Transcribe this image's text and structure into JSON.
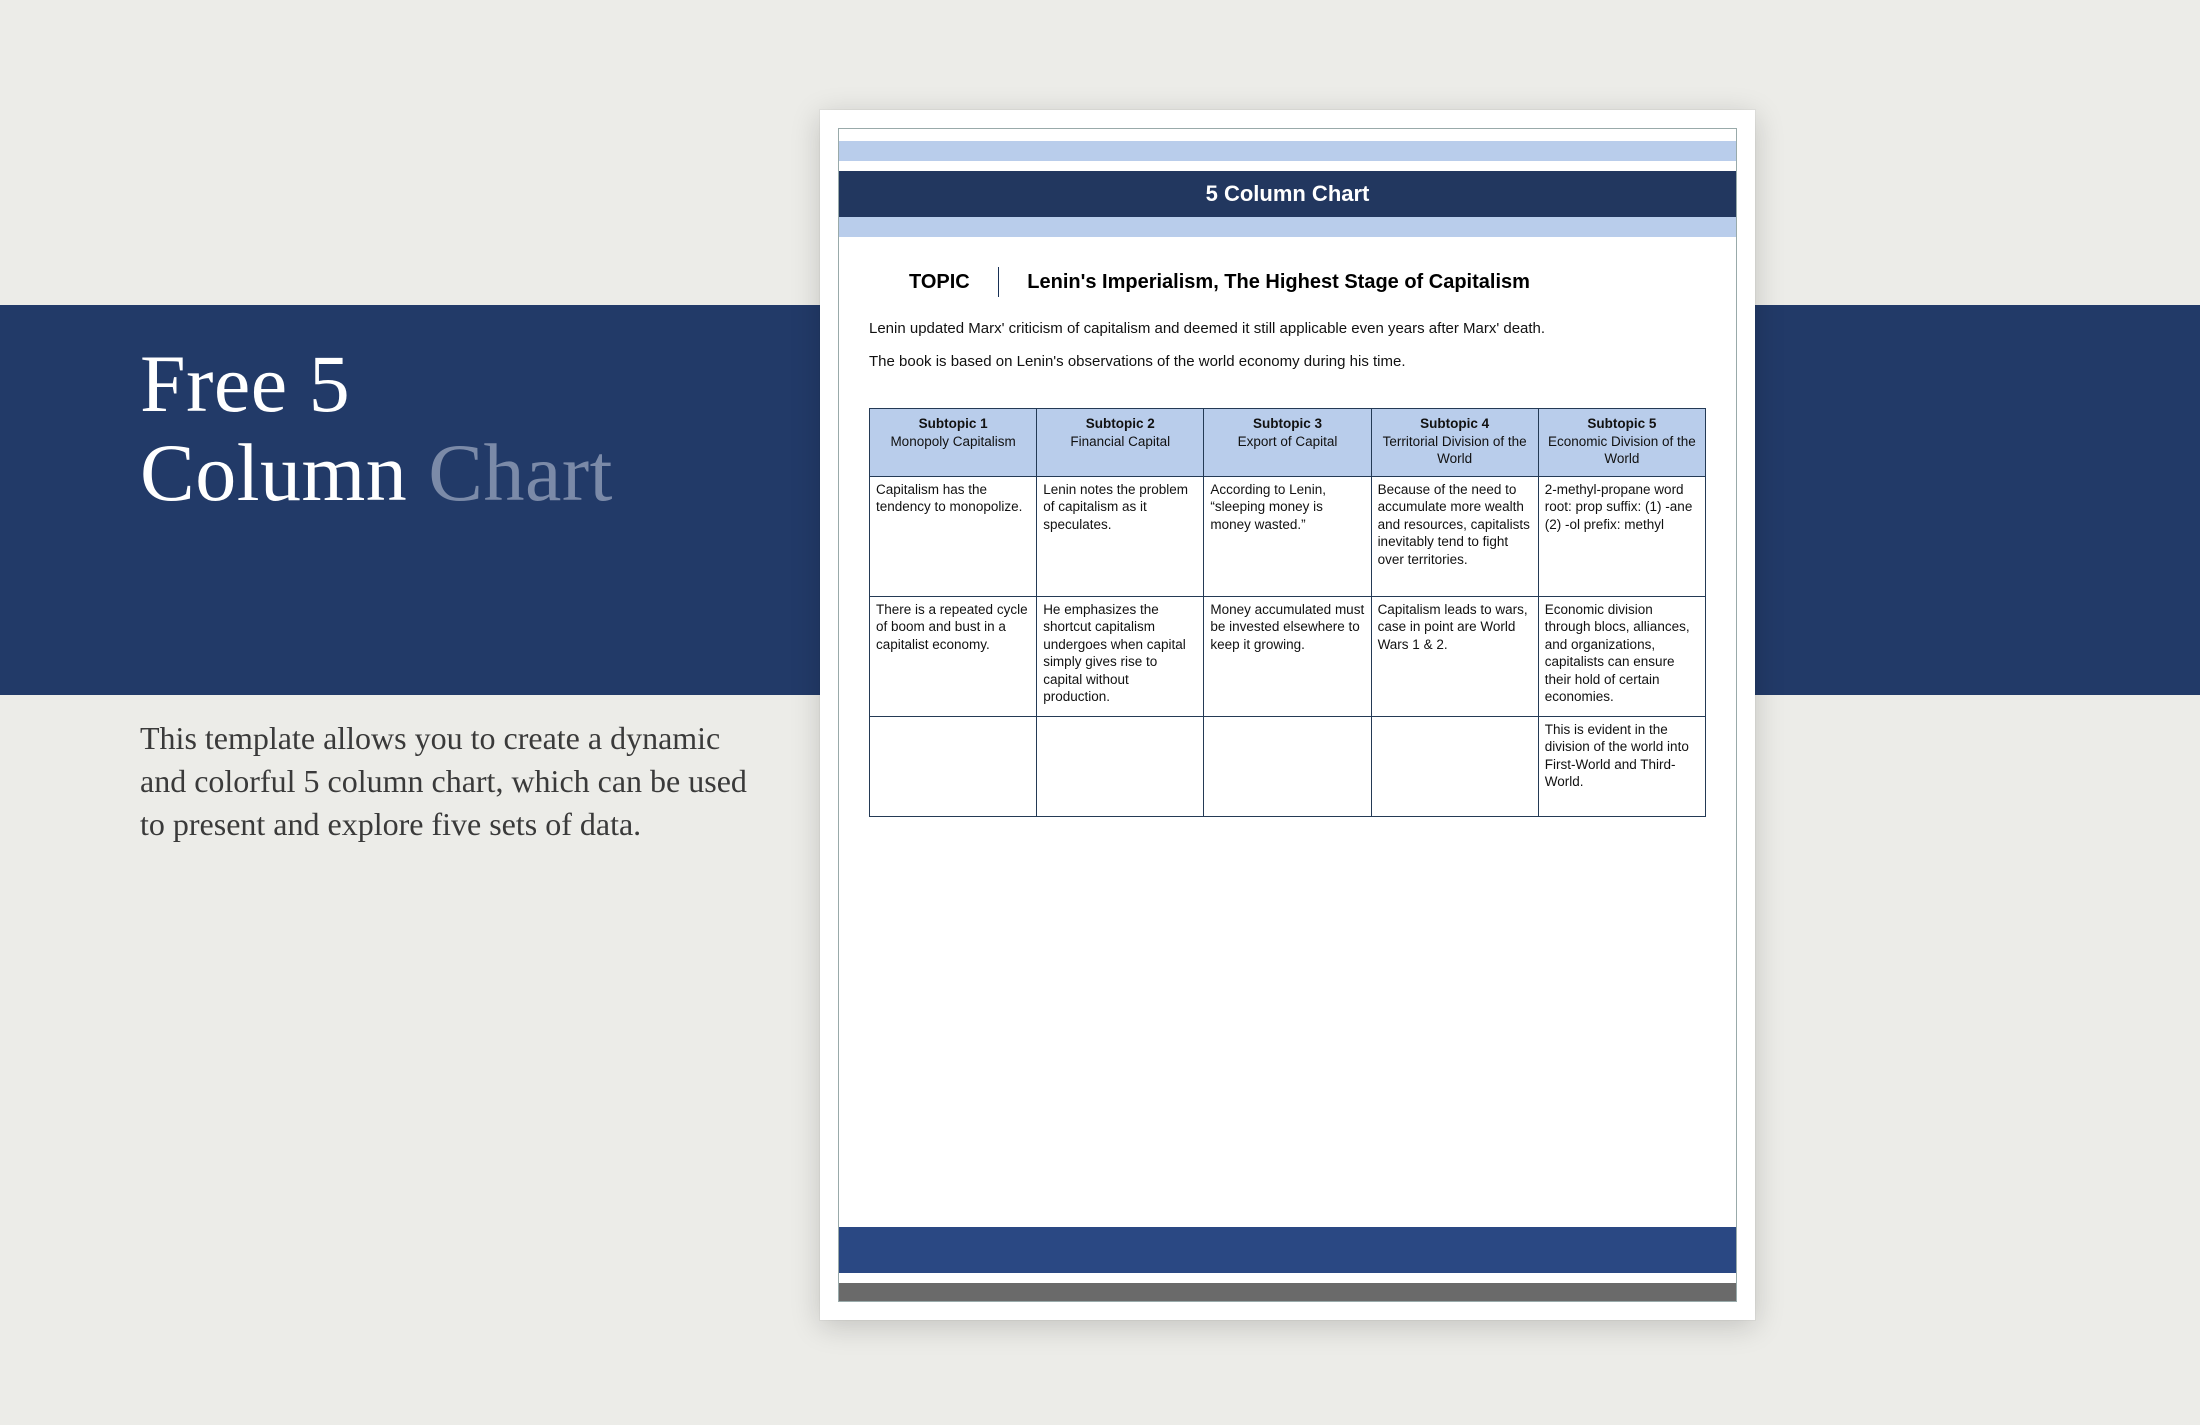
{
  "left": {
    "headline_1": "Free 5",
    "headline_2a": "Column ",
    "headline_2b": "Chart",
    "description": "This template allows you to create a dynamic and colorful 5 column chart, which can be used to present and explore five sets of data."
  },
  "page": {
    "title": "5 Column Chart",
    "topic_label": "TOPIC",
    "topic_value": "Lenin's Imperialism, The Highest Stage of Capitalism",
    "para1": "Lenin updated Marx' criticism of capitalism and deemed it still applicable even years after Marx' death.",
    "para2": "The book is based on Lenin's observations of the world economy during his time."
  },
  "chart_data": {
    "type": "table",
    "columns": [
      {
        "label": "Subtopic 1",
        "name": "Monopoly Capitalism"
      },
      {
        "label": "Subtopic 2",
        "name": "Financial Capital"
      },
      {
        "label": "Subtopic 3",
        "name": "Export of Capital"
      },
      {
        "label": "Subtopic 4",
        "name": "Territorial Division of the World"
      },
      {
        "label": "Subtopic 5",
        "name": "Economic Division of the World"
      }
    ],
    "rows": [
      [
        "Capitalism has the tendency to monopolize.",
        "Lenin notes the problem of capitalism as it speculates.",
        "According to Lenin, “sleeping money is money wasted.”",
        "Because of the need to accumulate more wealth and resources, capitalists inevitably tend to fight over territories.",
        "2-methyl-propane word root: prop suffix: (1) -ane (2) -ol prefix: methyl"
      ],
      [
        "There is a repeated cycle of boom and bust in a capitalist economy.",
        "He emphasizes the shortcut capitalism undergoes when capital simply gives rise to capital without production.",
        "Money accumulated must be invested elsewhere to keep it growing.",
        "Capitalism leads to wars, case in point are World Wars 1 & 2.",
        "Economic division through blocs, alliances, and organizations, capitalists can ensure their hold of certain economies."
      ],
      [
        "",
        "",
        "",
        "",
        "This is evident in the division of the world into First-World and Third-World."
      ]
    ]
  }
}
